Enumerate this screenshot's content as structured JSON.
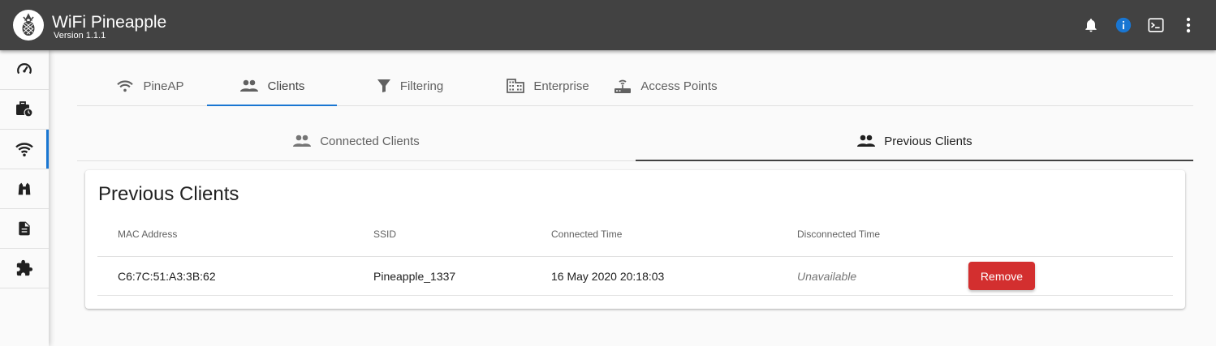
{
  "app": {
    "title": "WiFi Pineapple",
    "version": "Version 1.1.1"
  },
  "colors": {
    "topbar": "#424242",
    "accent": "#1976d2",
    "remove": "#d32f2f"
  },
  "header_icons": [
    "bell-icon",
    "info-icon",
    "terminal-icon",
    "more-vert-icon"
  ],
  "sidebar": {
    "items": [
      {
        "icon": "speedometer-icon",
        "active": false
      },
      {
        "icon": "briefcase-clock-icon",
        "active": false
      },
      {
        "icon": "wifi-icon",
        "active": true
      },
      {
        "icon": "binoculars-icon",
        "active": false
      },
      {
        "icon": "file-document-icon",
        "active": false
      },
      {
        "icon": "puzzle-icon",
        "active": false
      }
    ]
  },
  "main_tabs": [
    {
      "label": "PineAP",
      "icon": "wifi-icon"
    },
    {
      "label": "Clients",
      "icon": "people-icon",
      "active": true
    },
    {
      "label": "Filtering",
      "icon": "filter-icon"
    },
    {
      "label": "Enterprise",
      "icon": "building-icon"
    },
    {
      "label": "Access Points",
      "icon": "router-icon"
    }
  ],
  "sub_tabs": [
    {
      "label": "Connected Clients",
      "icon": "people-icon"
    },
    {
      "label": "Previous Clients",
      "icon": "people-icon",
      "active": true
    }
  ],
  "card": {
    "title": "Previous Clients",
    "columns": [
      "MAC Address",
      "SSID",
      "Connected Time",
      "Disconnected Time"
    ],
    "rows": [
      {
        "mac": "C6:7C:51:A3:3B:62",
        "ssid": "Pineapple_1337",
        "connected": "16 May 2020 20:18:03",
        "disconnected": "Unavailable",
        "action": "Remove"
      }
    ]
  }
}
